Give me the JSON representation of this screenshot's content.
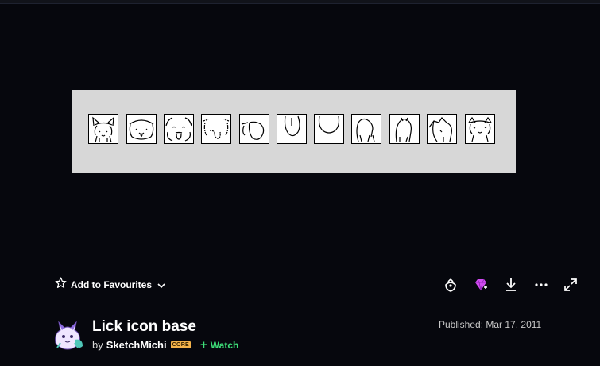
{
  "actions": {
    "favourite_label": "Add to Favourites"
  },
  "deviation": {
    "title": "Lick icon base",
    "by_prefix": "by",
    "author": "SketchMichi",
    "core_badge": "CORE",
    "watch_label": "Watch",
    "published": "Published: Mar 17, 2011"
  },
  "colors": {
    "page_bg": "#06070d",
    "artwork_bg": "#d7d7d7",
    "watch_green": "#3ee079",
    "core_badge": "#f3b24a",
    "gem": "#d04cf0"
  },
  "icons": {
    "favourite": "star-icon",
    "more": "chevron-down-icon",
    "gift": "gift-icon",
    "points": "gem-icon",
    "download": "download-icon",
    "options": "ellipsis-icon",
    "expand": "expand-icon"
  }
}
